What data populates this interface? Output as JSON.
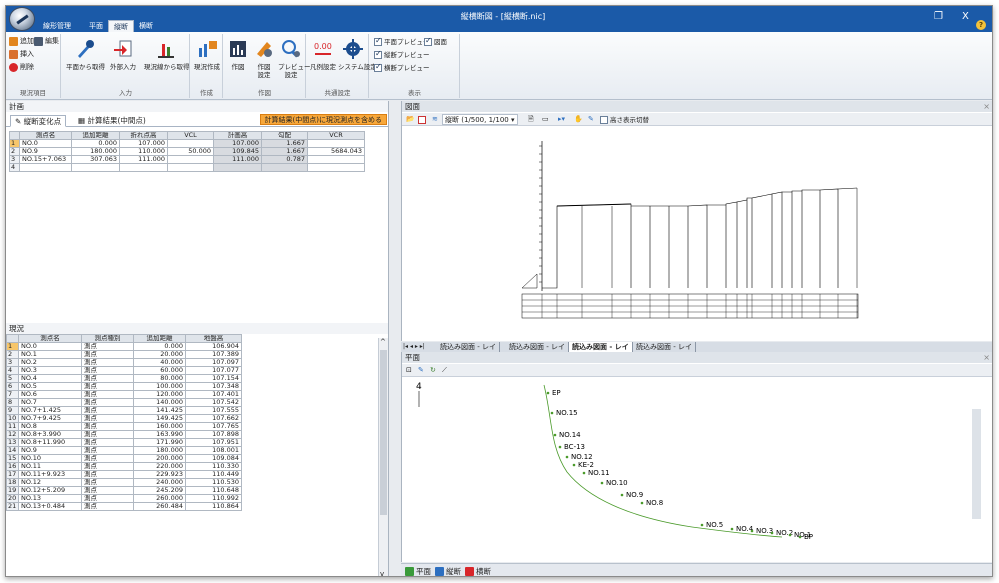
{
  "window": {
    "title": "縦横断図 - [縦横断.nic]",
    "restore": "❐",
    "close": "X"
  },
  "ribbon_tabs": [
    "線形管理",
    "平面",
    "縦断",
    "横断"
  ],
  "ribbon_active_tab": 2,
  "ribbon": {
    "group_genkyo": {
      "add": "追加",
      "edit": "編集",
      "insert": "挿入",
      "delete": "削除",
      "label": "現況項目"
    },
    "group_input": {
      "from_plan": "平面から取得",
      "external": "外部入力",
      "from_genkyo": "現況線から取得",
      "label": "入力"
    },
    "group_create": {
      "genkyo_create": "現況作成",
      "label": "作成"
    },
    "group_draw": {
      "draw": "作図",
      "draw_settings": "作図\n設定",
      "preview_settings": "プレビュー\n設定",
      "label": "作図"
    },
    "group_common": {
      "legend": "凡例設定",
      "system": "システム設定",
      "label": "共通設定"
    },
    "group_display": {
      "plan_preview": "平面プレビュー",
      "plan_figure": "図面",
      "profile_preview": "縦断プレビュー",
      "cross_preview": "横断プレビュー",
      "label": "表示"
    }
  },
  "left": {
    "plan_title": "計画",
    "tabs": [
      "縦断変化点",
      "計算結果(中間点)"
    ],
    "calc_button": "計算結果(中間点)に現況測点を含める",
    "plan_table": {
      "headers": [
        "測点名",
        "追加距離",
        "折れ点高",
        "VCL",
        "計画高",
        "勾配",
        "VCR"
      ],
      "rows": [
        [
          "1",
          "NO.0",
          "0.000",
          "107.000",
          "",
          "107.000",
          "1.667",
          ""
        ],
        [
          "2",
          "NO.9",
          "180.000",
          "110.000",
          "50.000",
          "109.845",
          "1.667",
          "5684.043"
        ],
        [
          "3",
          "NO.15+7.063",
          "307.063",
          "111.000",
          "",
          "111.000",
          "0.787",
          ""
        ],
        [
          "4",
          "",
          "",
          "",
          "",
          "",
          "",
          ""
        ]
      ]
    },
    "genkyo_title": "現況",
    "genkyo_table": {
      "headers": [
        "測点名",
        "測点種別",
        "追加距離",
        "地盤高"
      ],
      "rows": [
        [
          "1",
          "NO.0",
          "測点",
          "0.000",
          "106.904"
        ],
        [
          "2",
          "NO.1",
          "測点",
          "20.000",
          "107.389"
        ],
        [
          "3",
          "NO.2",
          "測点",
          "40.000",
          "107.097"
        ],
        [
          "4",
          "NO.3",
          "測点",
          "60.000",
          "107.077"
        ],
        [
          "5",
          "NO.4",
          "測点",
          "80.000",
          "107.154"
        ],
        [
          "6",
          "NO.5",
          "測点",
          "100.000",
          "107.348"
        ],
        [
          "7",
          "NO.6",
          "測点",
          "120.000",
          "107.401"
        ],
        [
          "8",
          "NO.7",
          "測点",
          "140.000",
          "107.542"
        ],
        [
          "9",
          "NO.7+1.425",
          "測点",
          "141.425",
          "107.555"
        ],
        [
          "10",
          "NO.7+9.425",
          "測点",
          "149.425",
          "107.662"
        ],
        [
          "11",
          "NO.8",
          "測点",
          "160.000",
          "107.765"
        ],
        [
          "12",
          "NO.8+3.990",
          "測点",
          "163.990",
          "107.898"
        ],
        [
          "13",
          "NO.8+11.990",
          "測点",
          "171.990",
          "107.951"
        ],
        [
          "14",
          "NO.9",
          "測点",
          "180.000",
          "108.001"
        ],
        [
          "15",
          "NO.10",
          "測点",
          "200.000",
          "109.084"
        ],
        [
          "16",
          "NO.11",
          "測点",
          "220.000",
          "110.330"
        ],
        [
          "17",
          "NO.11+9.923",
          "測点",
          "229.923",
          "110.449"
        ],
        [
          "18",
          "NO.12",
          "測点",
          "240.000",
          "110.530"
        ],
        [
          "19",
          "NO.12+5.209",
          "測点",
          "245.209",
          "110.648"
        ],
        [
          "20",
          "NO.13",
          "測点",
          "260.000",
          "110.992"
        ],
        [
          "21",
          "NO.13+0.484",
          "測点",
          "260.484",
          "110.864"
        ]
      ]
    }
  },
  "figure_panel": {
    "title": "図面",
    "scale": "縦断 (1/500, 1/100",
    "height_toggle": "高さ表示切替"
  },
  "sheet_tabs": [
    "読込み図面 - レイ",
    "読込み図面 - レイ",
    "読込み図面 - レイ",
    "読込み図面 - レイ"
  ],
  "plan_panel": {
    "title": "平面",
    "labels": [
      "EP",
      "NO.15",
      "NO.14",
      "BC-13",
      "NO.12",
      "KE-2",
      "NO.11",
      "NO.10",
      "NO.9",
      "NO.8",
      "NO.5",
      "NO.4",
      "NO.3",
      "NO.2",
      "NO.1",
      "BP"
    ]
  },
  "status_tabs": [
    "平面",
    "縦断",
    "横断"
  ]
}
